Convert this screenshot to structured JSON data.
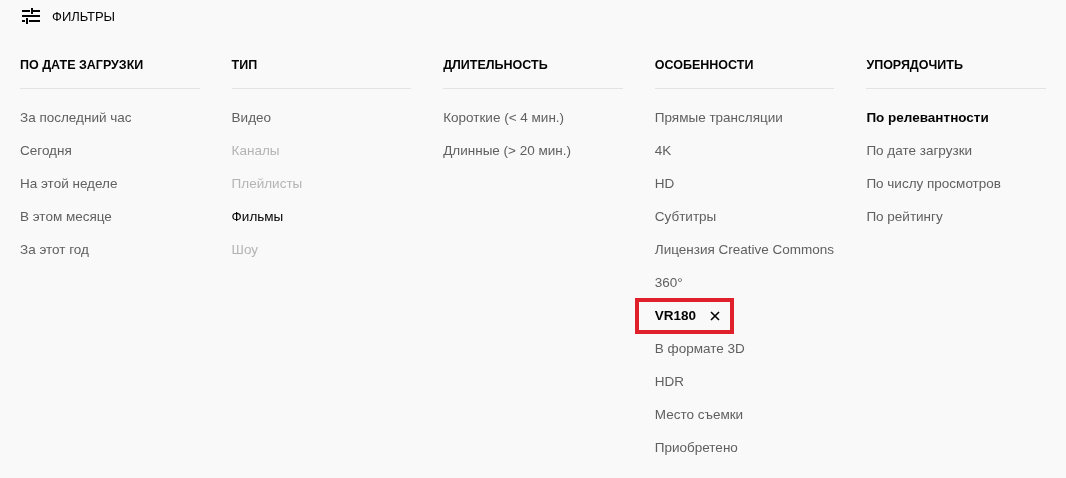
{
  "header": {
    "title": "ФИЛЬТРЫ"
  },
  "columns": [
    {
      "title": "ПО ДАТЕ ЗАГРУЗКИ",
      "kind": "filter",
      "items": [
        {
          "label": "За последний час",
          "disabled": false,
          "selected": false,
          "hovered": false,
          "highlighted": false
        },
        {
          "label": "Сегодня",
          "disabled": false,
          "selected": false,
          "hovered": false,
          "highlighted": false
        },
        {
          "label": "На этой неделе",
          "disabled": false,
          "selected": false,
          "hovered": false,
          "highlighted": false
        },
        {
          "label": "В этом месяце",
          "disabled": false,
          "selected": false,
          "hovered": false,
          "highlighted": false
        },
        {
          "label": "За этот год",
          "disabled": false,
          "selected": false,
          "hovered": false,
          "highlighted": false
        }
      ]
    },
    {
      "title": "ТИП",
      "kind": "filter",
      "items": [
        {
          "label": "Видео",
          "disabled": false,
          "selected": false,
          "hovered": false,
          "highlighted": false
        },
        {
          "label": "Каналы",
          "disabled": true,
          "selected": false,
          "hovered": false,
          "highlighted": false
        },
        {
          "label": "Плейлисты",
          "disabled": true,
          "selected": false,
          "hovered": false,
          "highlighted": false
        },
        {
          "label": "Фильмы",
          "disabled": false,
          "selected": false,
          "hovered": true,
          "highlighted": false
        },
        {
          "label": "Шоу",
          "disabled": true,
          "selected": false,
          "hovered": false,
          "highlighted": false
        }
      ]
    },
    {
      "title": "ДЛИТЕЛЬНОСТЬ",
      "kind": "filter",
      "items": [
        {
          "label": "Короткие (< 4 мин.)",
          "disabled": false,
          "selected": false,
          "hovered": false,
          "highlighted": false
        },
        {
          "label": "Длинные (> 20 мин.)",
          "disabled": false,
          "selected": false,
          "hovered": false,
          "highlighted": false
        }
      ]
    },
    {
      "title": "ОСОБЕННОСТИ",
      "kind": "filter",
      "items": [
        {
          "label": "Прямые трансляции",
          "disabled": false,
          "selected": false,
          "hovered": false,
          "highlighted": false
        },
        {
          "label": "4K",
          "disabled": false,
          "selected": false,
          "hovered": false,
          "highlighted": false
        },
        {
          "label": "HD",
          "disabled": false,
          "selected": false,
          "hovered": false,
          "highlighted": false
        },
        {
          "label": "Субтитры",
          "disabled": false,
          "selected": false,
          "hovered": false,
          "highlighted": false
        },
        {
          "label": "Лицензия Creative Commons",
          "disabled": false,
          "selected": false,
          "hovered": false,
          "highlighted": false
        },
        {
          "label": "360°",
          "disabled": false,
          "selected": false,
          "hovered": false,
          "highlighted": false
        },
        {
          "label": "VR180",
          "disabled": false,
          "selected": true,
          "hovered": false,
          "highlighted": true
        },
        {
          "label": "В формате 3D",
          "disabled": false,
          "selected": false,
          "hovered": false,
          "highlighted": false
        },
        {
          "label": "HDR",
          "disabled": false,
          "selected": false,
          "hovered": false,
          "highlighted": false
        },
        {
          "label": "Место съемки",
          "disabled": false,
          "selected": false,
          "hovered": false,
          "highlighted": false
        },
        {
          "label": "Приобретено",
          "disabled": false,
          "selected": false,
          "hovered": false,
          "highlighted": false
        }
      ]
    },
    {
      "title": "УПОРЯДОЧИТЬ",
      "kind": "sort",
      "items": [
        {
          "label": "По релевантности",
          "disabled": false,
          "selected": true,
          "hovered": false,
          "highlighted": false
        },
        {
          "label": "По дате загрузки",
          "disabled": false,
          "selected": false,
          "hovered": false,
          "highlighted": false
        },
        {
          "label": "По числу просмотров",
          "disabled": false,
          "selected": false,
          "hovered": false,
          "highlighted": false
        },
        {
          "label": "По рейтингу",
          "disabled": false,
          "selected": false,
          "hovered": false,
          "highlighted": false
        }
      ]
    }
  ]
}
